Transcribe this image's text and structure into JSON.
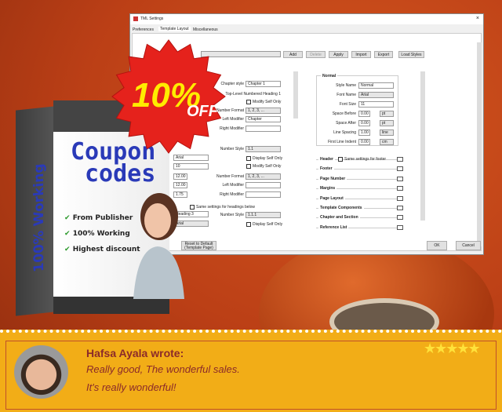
{
  "dialog": {
    "title": "TML Settings",
    "close": "×",
    "tabs": [
      "Preferences",
      "Template Layout",
      "Miscellaneous"
    ],
    "toolbar": {
      "add": "Add",
      "delete": "Delete",
      "apply": "Apply",
      "import": "Import",
      "export": "Export",
      "load_styles": "Load Styles"
    },
    "mid1": {
      "chapter_style_label": "Chapter style",
      "chapter_style": "Chapter 1",
      "heading_label": "Top-Level Numbered Heading 1",
      "modify_self_only": "Modify Self Only",
      "number_format_label": "Number Format",
      "number_format": "1, 2, 3, ...",
      "left_modifier_label": "Left Modifier",
      "left_modifier": "Chapter",
      "right_modifier_label": "Right Modifier",
      "right_modifier": ""
    },
    "mid2": {
      "number_style_label": "Number Style",
      "number_style": "1.1",
      "display_self_only": "Display Self Only",
      "modify_self_only": "Modify Self Only",
      "number_format_label": "Number Format",
      "number_format": "1, 2, 3, ...",
      "left_modifier_label": "Left Modifier",
      "right_modifier_label": "Right Modifier"
    },
    "mid3": {
      "same_settings": "Same settings for headings below",
      "number_style_label": "Number Style",
      "number_style": "1.1.1",
      "display_self_only": "Display Self Only"
    },
    "left": {
      "font": "Arial",
      "size": "10",
      "before": "12.00",
      "after": "12.00",
      "spacing": "1.75",
      "style3": "Heading 3",
      "font3": "Arial"
    },
    "normal": {
      "title": "Normal",
      "rows": [
        {
          "label": "Style Name",
          "value": "Normal"
        },
        {
          "label": "Font Name",
          "value": "Arial"
        },
        {
          "label": "Font Size",
          "value": "11"
        },
        {
          "label": "Space Before",
          "value": "0.00",
          "unit": "pt"
        },
        {
          "label": "Space After",
          "value": "0.00",
          "unit": "pt"
        },
        {
          "label": "Line Spacing",
          "value": "1.00",
          "unit": "line"
        },
        {
          "label": "First Line Indent",
          "value": "0.00",
          "unit": "cm"
        }
      ]
    },
    "sections": [
      "Header",
      "Footer",
      "Page Number",
      "Margins",
      "Page Layout",
      "Template Components",
      "Chapter and Section",
      "Reference List"
    ],
    "header_same_footer": "Same settings for footer",
    "reset": "Reset to Default (Template Page)",
    "ok": "OK",
    "cancel": "Cancel"
  },
  "promo": {
    "badge_big": "10%",
    "badge_off": "OFF",
    "coupon1": "Coupon",
    "coupon2": "codes",
    "side": "100% Working",
    "features": [
      "From Publisher",
      "100% Working",
      "Highest discount"
    ],
    "check": "✔"
  },
  "review": {
    "name": "Hafsa Ayala wrote:",
    "line1": "Really good, The wonderful sales.",
    "line2": "It's really wonderful!",
    "stars": "★★★★★",
    "rating": 5,
    "star_color": "#ffe23a"
  }
}
